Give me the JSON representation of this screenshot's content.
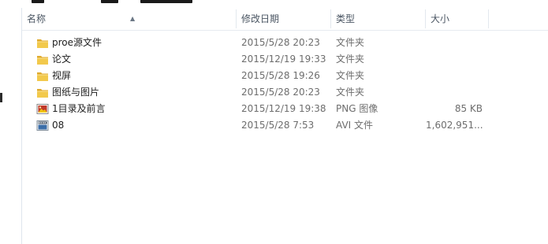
{
  "columns": {
    "name": "名称",
    "date": "修改日期",
    "type": "类型",
    "size": "大小"
  },
  "files": [
    {
      "name": "proe源文件",
      "date": "2015/5/28 20:23",
      "type": "文件夹",
      "size": "",
      "icon": "folder-icon"
    },
    {
      "name": "论文",
      "date": "2015/12/19 19:33",
      "type": "文件夹",
      "size": "",
      "icon": "folder-icon"
    },
    {
      "name": "视屏",
      "date": "2015/5/28 19:26",
      "type": "文件夹",
      "size": "",
      "icon": "folder-icon"
    },
    {
      "name": "图纸与图片",
      "date": "2015/5/28 20:23",
      "type": "文件夹",
      "size": "",
      "icon": "folder-icon"
    },
    {
      "name": "1目录及前言",
      "date": "2015/12/19 19:38",
      "type": "PNG 图像",
      "size": "85 KB",
      "icon": "png-image-icon"
    },
    {
      "name": "08",
      "date": "2015/5/28 7:53",
      "type": "AVI 文件",
      "size": "1,602,951...",
      "icon": "avi-video-icon"
    }
  ],
  "colors": {
    "folder": "#f2c94c",
    "header_text": "#4b5663",
    "secondary_text": "#6d6d6d"
  }
}
